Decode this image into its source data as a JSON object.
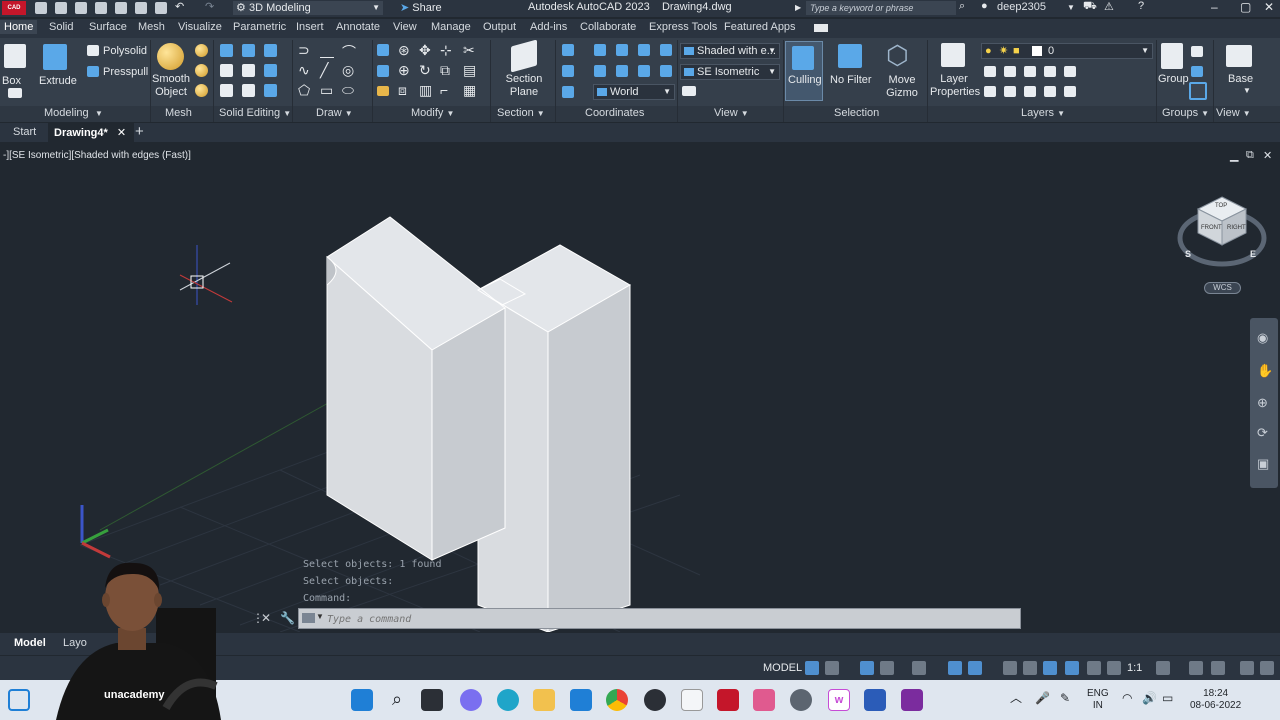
{
  "titlebar": {
    "app_badge": "CAD",
    "workspace": "3D Modeling",
    "share": "Share",
    "app_name": "Autodesk AutoCAD 2023",
    "file_name": "Drawing4.dwg",
    "search_placeholder": "Type a keyword or phrase",
    "user": "deep2305"
  },
  "ribbon_tabs": [
    "Home",
    "Solid",
    "Surface",
    "Mesh",
    "Visualize",
    "Parametric",
    "Insert",
    "Annotate",
    "View",
    "Manage",
    "Output",
    "Add-ins",
    "Collaborate",
    "Express Tools",
    "Featured Apps"
  ],
  "ribbon": {
    "modeling": {
      "box": "Box",
      "extrude": "Extrude",
      "polysolid": "Polysolid",
      "presspull": "Presspull",
      "footer": "Modeling"
    },
    "mesh": {
      "smooth_object_1": "Smooth",
      "smooth_object_2": "Object",
      "footer": "Mesh"
    },
    "solid_editing": {
      "footer": "Solid Editing"
    },
    "draw": {
      "footer": "Draw"
    },
    "modify": {
      "footer": "Modify"
    },
    "section": {
      "section_plane_1": "Section",
      "section_plane_2": "Plane",
      "footer": "Section"
    },
    "coordinates": {
      "ucs": "World",
      "footer": "Coordinates"
    },
    "view": {
      "visual_style": "Shaded with e...",
      "view_name": "SE Isometric",
      "footer": "View"
    },
    "selection": {
      "culling": "Culling",
      "no_filter": "No Filter",
      "move_gizmo_1": "Move",
      "move_gizmo_2": "Gizmo",
      "footer": "Selection"
    },
    "layers": {
      "layer_properties_1": "Layer",
      "layer_properties_2": "Properties",
      "current_layer": "0",
      "footer": "Layers"
    },
    "groups": {
      "group": "Group",
      "footer": "Groups"
    },
    "view2": {
      "base": "Base",
      "footer": "View"
    }
  },
  "file_tabs": {
    "start": "Start",
    "drawing": "Drawing4*"
  },
  "viewport": {
    "label": "-][SE Isometric][Shaded with edges (Fast)]",
    "viewcube": {
      "top": "TOP",
      "front": "FRONT",
      "right": "RIGHT",
      "s": "S",
      "e": "E",
      "wcs": "WCS"
    }
  },
  "command": {
    "history": [
      "Select objects: 1 found",
      "Select objects:",
      "Command:"
    ],
    "placeholder": "Type a command"
  },
  "layout_tabs": {
    "model": "Model",
    "layout": "Layo"
  },
  "statusbar": {
    "model": "MODEL",
    "scale": "1:1"
  },
  "webcam": {
    "brand": "unacademy"
  },
  "taskbar": {
    "lang_1": "ENG",
    "lang_2": "IN",
    "time": "18:24",
    "date": "08-06-2022"
  },
  "colors": {
    "accent": "#4f8fcf",
    "autocad_red": "#c4162a",
    "background": "#212830"
  }
}
